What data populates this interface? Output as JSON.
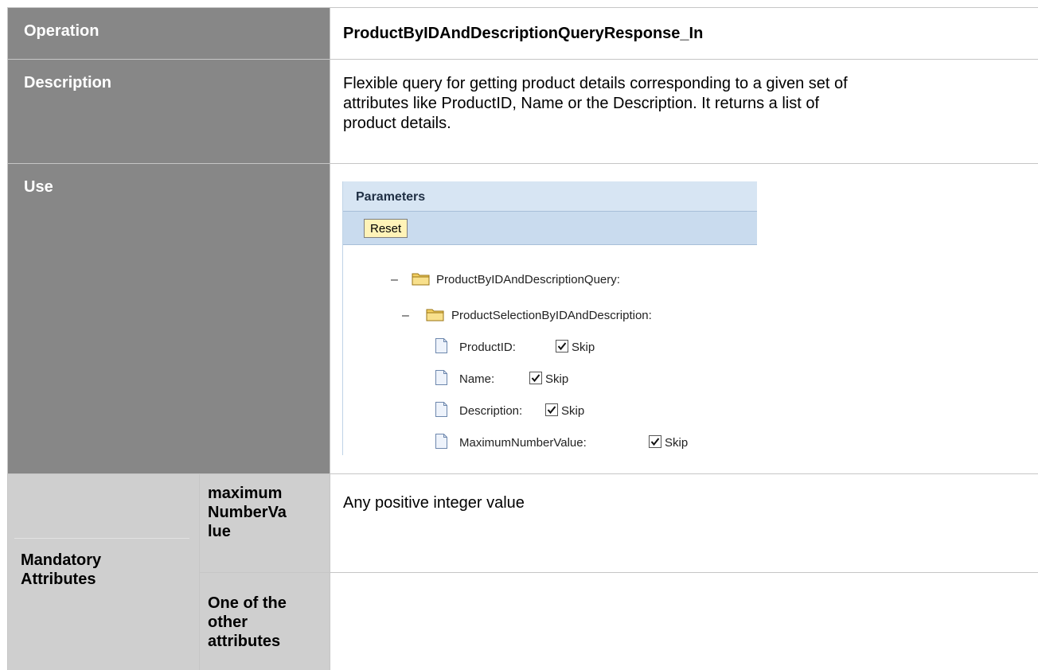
{
  "operation": {
    "label": "Operation",
    "value": "ProductByIDAndDescriptionQueryResponse_In"
  },
  "description": {
    "label": "Description",
    "lines": [
      "Flexible query for getting product details corresponding to a given set of",
      "attributes like ProductID, Name or the Description. It returns a list of",
      "product details."
    ]
  },
  "use": {
    "label": "Use",
    "panel": {
      "title": "Parameters",
      "reset_label": "Reset",
      "root": "ProductByIDAndDescriptionQuery:",
      "selection": "ProductSelectionByIDAndDescription:",
      "fields": [
        {
          "name": "ProductID:",
          "skip_label": "Skip",
          "checked": true
        },
        {
          "name": "Name:",
          "skip_label": "Skip",
          "checked": true
        },
        {
          "name": "Description:",
          "skip_label": "Skip",
          "checked": true
        },
        {
          "name": "MaximumNumberValue:",
          "skip_label": "Skip",
          "checked": true
        }
      ]
    }
  },
  "mandatory": {
    "label_lines": [
      "Mandatory",
      "Attributes"
    ],
    "rows": [
      {
        "attribute_lines": [
          "maximum",
          "NumberVa",
          "lue"
        ],
        "value": "Any positive integer value"
      },
      {
        "attribute_lines": [
          "One of the",
          "other",
          "attributes"
        ],
        "value": ""
      }
    ]
  },
  "colors": {
    "header_bg": "#878787",
    "sub_bg": "#cfcfcf",
    "panel_title_bg": "#d7e5f3",
    "panel_toolbar_bg": "#c9dbee",
    "reset_bg": "#fff3b8",
    "folder": "#e8b83a"
  }
}
